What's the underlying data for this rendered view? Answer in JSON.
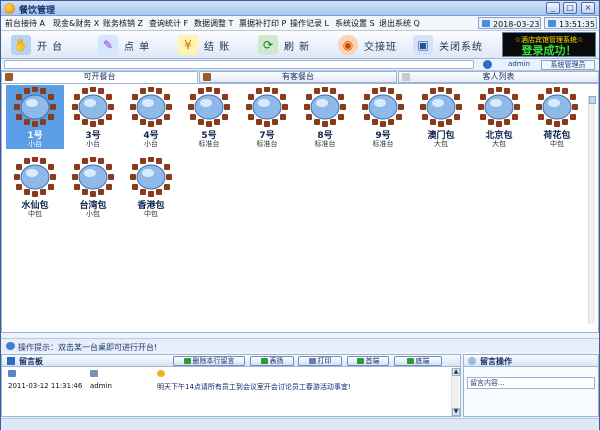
{
  "window": {
    "title": "餐饮管理",
    "controls": [
      "_",
      "□",
      "×"
    ]
  },
  "menu": {
    "items": [
      "前台接待 A",
      "现金&财务 X",
      "账务核销 Z",
      "查询统计 F",
      "数据调整 T",
      "票据补打印 P",
      "操作记录 L",
      "系统设置 S",
      "退出系统 Q"
    ],
    "date": "2018-03-23",
    "time": "13:51:35"
  },
  "toolbar": {
    "buttons": [
      {
        "label": "开 台",
        "icon": "hand-icon"
      },
      {
        "label": "点 单",
        "icon": "order-icon"
      },
      {
        "label": "结 账",
        "icon": "checkout-icon"
      },
      {
        "label": "刷 新",
        "icon": "refresh-icon"
      },
      {
        "label": "交接班",
        "icon": "shift-icon"
      },
      {
        "label": "关闭系统",
        "icon": "shutdown-icon"
      }
    ],
    "banner_top": "☆酒店宾馆管理系统☆",
    "banner_main": "登录成功！"
  },
  "userbar": {
    "username": "admin",
    "role": "系统管理员"
  },
  "tabs": [
    {
      "label": "可开餐台",
      "active": true
    },
    {
      "label": "有客餐台",
      "active": false
    },
    {
      "label": "客人列表",
      "active": false
    }
  ],
  "tables": [
    {
      "name": "1号",
      "type": "小台",
      "selected": true
    },
    {
      "name": "3号",
      "type": "小台",
      "selected": false
    },
    {
      "name": "4号",
      "type": "小台",
      "selected": false
    },
    {
      "name": "5号",
      "type": "标准台",
      "selected": false
    },
    {
      "name": "7号",
      "type": "标准台",
      "selected": false
    },
    {
      "name": "8号",
      "type": "标准台",
      "selected": false
    },
    {
      "name": "9号",
      "type": "标准台",
      "selected": false
    },
    {
      "name": "澳门包",
      "type": "大包",
      "selected": false
    },
    {
      "name": "北京包",
      "type": "大包",
      "selected": false
    },
    {
      "name": "荷花包",
      "type": "中包",
      "selected": false
    },
    {
      "name": "水仙包",
      "type": "中包",
      "selected": false
    },
    {
      "name": "台湾包",
      "type": "小包",
      "selected": false
    },
    {
      "name": "香港包",
      "type": "中包",
      "selected": false
    }
  ],
  "hint": "操作提示：双击某一台桌即可进行开台!",
  "messages": {
    "title": "留言板",
    "buttons": [
      "删除本行留言",
      "表扬",
      "打印",
      "首端",
      "底端"
    ],
    "rows": [
      {
        "date": "2011-03-12 11:31:46",
        "user": "admin",
        "text": "明天下午14点请所有员工到会议室开会讨论员工春游活动事宜!"
      }
    ]
  },
  "operation": {
    "title": "留言操作",
    "placeholder": "留言内容..."
  },
  "colors": {
    "accent": "#5b9ee6",
    "banner_text": "#38e238",
    "banner_top": "#ffe600"
  }
}
